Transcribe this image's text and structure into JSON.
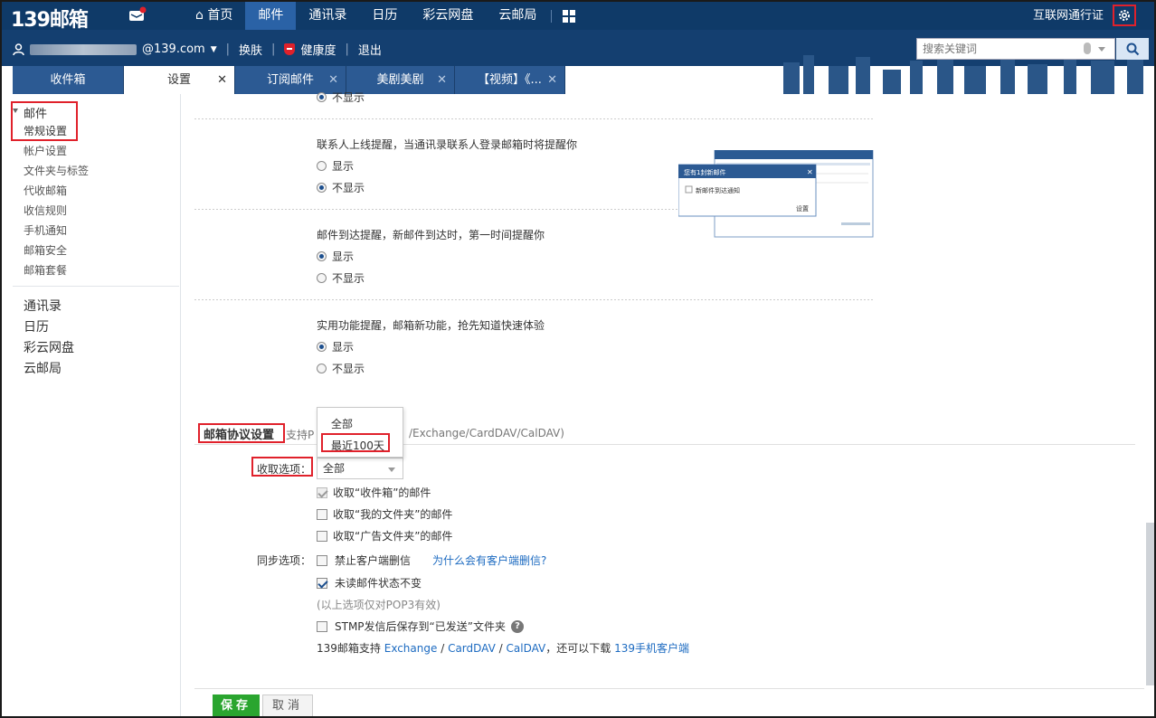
{
  "app": {
    "logo": "139邮箱",
    "nav": [
      "首页",
      "邮件",
      "通讯录",
      "日历",
      "彩云网盘",
      "云邮局"
    ],
    "nav_active_index": 1,
    "top_right_link": "互联网通行证"
  },
  "userbar": {
    "email_suffix": "@139.com",
    "links": [
      "换肤",
      "健康度",
      "退出"
    ],
    "search_placeholder": "搜索关键词"
  },
  "tabs": [
    {
      "label": "收件箱",
      "closable": false,
      "active": false
    },
    {
      "label": "设置",
      "closable": true,
      "active": true
    },
    {
      "label": "订阅邮件",
      "closable": true,
      "active": false
    },
    {
      "label": "美剧美剧",
      "closable": true,
      "active": false
    },
    {
      "label": "【视频】《...",
      "closable": true,
      "active": false
    }
  ],
  "sidebar": {
    "group_label": "邮件",
    "items": [
      "常规设置",
      "帐户设置",
      "文件夹与标签",
      "代收邮箱",
      "收信规则",
      "手机通知",
      "邮箱安全",
      "邮箱套餐"
    ],
    "apps": [
      "通讯录",
      "日历",
      "彩云网盘",
      "云邮局"
    ]
  },
  "settings": {
    "top_partial_option": "不显示",
    "contact_online": {
      "question": "联系人上线提醒，当通讯录联系人登录邮箱时将提醒你",
      "options": [
        "显示",
        "不显示"
      ],
      "selected": 1
    },
    "mail_arrival": {
      "question": "邮件到达提醒，新邮件到达时，第一时间提醒你",
      "options": [
        "显示",
        "不显示"
      ],
      "selected": 0
    },
    "feature_tips": {
      "question": "实用功能提醒，邮箱新功能，抢先知道快速体验",
      "options": [
        "显示",
        "不显示"
      ],
      "selected": 0
    },
    "preview": {
      "popup_title": "您有1封新邮件",
      "checkbox_label": "新邮件到达通知",
      "setting_label": "设置"
    }
  },
  "protocol": {
    "title": "邮箱协议设置",
    "subtitle_prefix": "支持P",
    "subtitle_suffix": "/Exchange/CardDAV/CalDAV)",
    "dropdown_options": [
      "全部",
      "最近100天"
    ],
    "fetch_label": "收取选项：",
    "fetch_value": "全部",
    "fetch_checkboxes": [
      {
        "label": "收取“收件箱”的邮件",
        "checked": true,
        "disabled": true
      },
      {
        "label": "收取“我的文件夹”的邮件",
        "checked": false,
        "disabled": false
      },
      {
        "label": "收取“广告文件夹”的邮件",
        "checked": false,
        "disabled": false
      }
    ],
    "sync_label": "同步选项：",
    "sync_checkboxes": [
      {
        "label": "禁止客户端删信",
        "checked": false
      },
      {
        "label": "未读邮件状态不变",
        "checked": true
      }
    ],
    "sync_link": "为什么会有客户端删信?",
    "pop3_note": "(以上选项仅对POP3有效)",
    "smtp_label": "STMP发信后保存到“已发送”文件夹",
    "support_prefix": "139邮箱支持",
    "support_links": [
      "Exchange",
      "CardDAV",
      "CalDAV"
    ],
    "support_middle": "，还可以下载",
    "client_link": "139手机客户端"
  },
  "buttons": {
    "save": "保存",
    "cancel": "取消"
  },
  "colors": {
    "nav_bg": "#0f3a68",
    "accent_green": "#2aa52f",
    "highlight_red": "#e0212b",
    "link_blue": "#1d6bc1"
  }
}
